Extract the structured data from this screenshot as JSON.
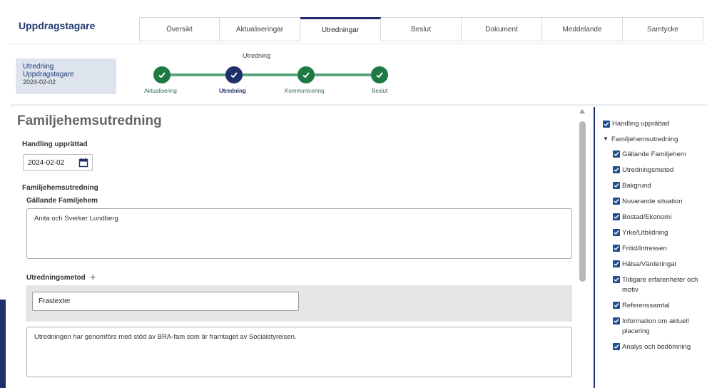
{
  "app": {
    "title": "Uppdragstagare"
  },
  "tabs": [
    "Översikt",
    "Aktualiseringar",
    "Utredningar",
    "Beslut",
    "Dokument",
    "Meddelande",
    "Samtycke"
  ],
  "info_card": {
    "line1": "Utredning",
    "line2": "Uppdragstagare",
    "date": "2024-02-02"
  },
  "stepper": {
    "title": "Utredning",
    "steps": [
      "Aktualisering",
      "Utredning",
      "Kommunicering",
      "Beslut"
    ]
  },
  "main": {
    "section_title": "Familjehemsutredning",
    "handling_label": "Handling upprättad",
    "handling_date": "2024-02-02",
    "fam_label": "Familjehemsutredning",
    "gallande_label": "Gällande Familjehem",
    "gallande_value": "Anita och Sverker Lundberg",
    "metod_label": "Utredningsmetod",
    "plus_icon": "+",
    "frastexter": "Frastexter",
    "metod_text": "Utredningen har genomförs med stöd av BRA-fam som är framtaget av Socialstyreisen."
  },
  "checklist": {
    "handling": "Handling upprättad",
    "group": "Familjehemsutredning",
    "items": [
      "Gällande Familjehem",
      "Utredningsmetod",
      "Bakgrund",
      "Nuvarande situation",
      "Bostad/Ekonomi",
      "Yrke/Utbildning",
      "Fritid/Intressen",
      "Hälsa/Värderingar",
      "Tidigare erfarenheter och motiv",
      "Referenssamtal",
      "Information om aktuell placering",
      "Analys och bedömning"
    ]
  },
  "colors": {
    "accent": "#1f2f6b",
    "step_done": "#1e7a45",
    "step_line": "#5aa67a",
    "checkbox": "#1f4f8f"
  },
  "icons": [
    "calendar-icon",
    "check-icon",
    "plus-icon",
    "caret-down-icon"
  ]
}
